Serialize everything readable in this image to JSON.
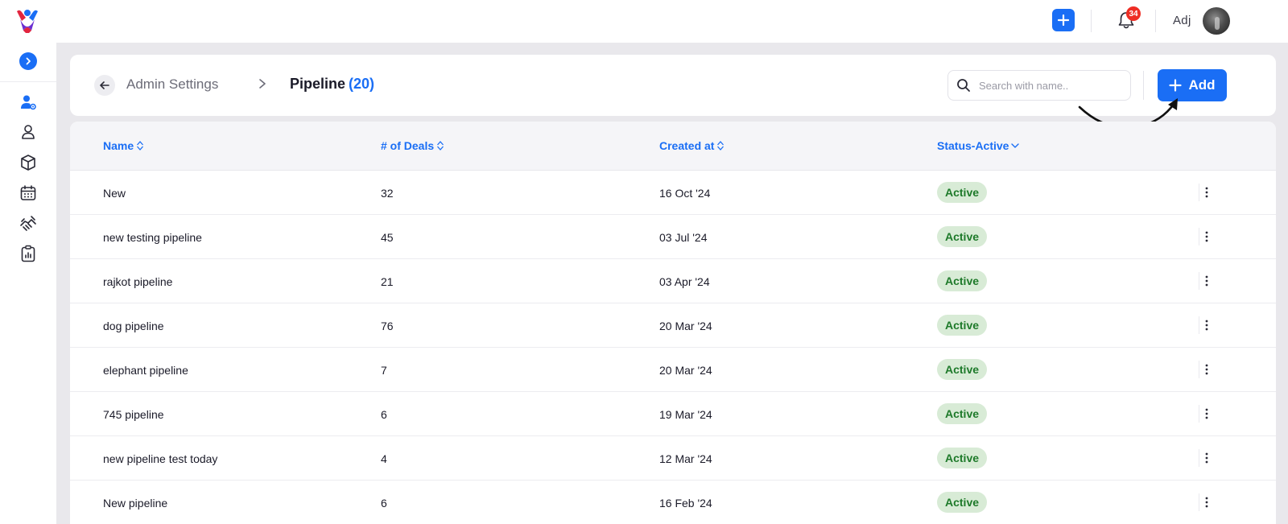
{
  "topbar": {
    "notification_count": "34",
    "user_name": "Adj"
  },
  "header": {
    "back_label": "Admin Settings",
    "page_title": "Pipeline",
    "count": "(20)",
    "search_placeholder": "Search with name..",
    "add_label": "Add"
  },
  "table": {
    "columns": {
      "name": "Name",
      "deals": "# of Deals",
      "created": "Created at",
      "status": "Status-Active"
    },
    "rows": [
      {
        "name": "New",
        "deals": "32",
        "created": "16 Oct '24",
        "status": "Active"
      },
      {
        "name": "new testing pipeline",
        "deals": "45",
        "created": "03 Jul '24",
        "status": "Active"
      },
      {
        "name": "rajkot pipeline",
        "deals": "21",
        "created": "03 Apr '24",
        "status": "Active"
      },
      {
        "name": "dog pipeline",
        "deals": "76",
        "created": "20 Mar '24",
        "status": "Active"
      },
      {
        "name": "elephant pipeline",
        "deals": "7",
        "created": "20 Mar '24",
        "status": "Active"
      },
      {
        "name": "745 pipeline",
        "deals": "6",
        "created": "19 Mar '24",
        "status": "Active"
      },
      {
        "name": "new pipeline test today",
        "deals": "4",
        "created": "12 Mar '24",
        "status": "Active"
      },
      {
        "name": "New pipeline",
        "deals": "6",
        "created": "16 Feb '24",
        "status": "Active"
      }
    ]
  },
  "colors": {
    "accent": "#1a6ef5",
    "status_bg": "#d8ebd6",
    "status_text": "#1e7a2a",
    "badge": "#ee2d24"
  },
  "icons": {
    "sidebar": [
      "user-settings-icon",
      "person-icon",
      "box-icon",
      "calendar-icon",
      "handshake-icon",
      "report-clipboard-icon"
    ]
  }
}
